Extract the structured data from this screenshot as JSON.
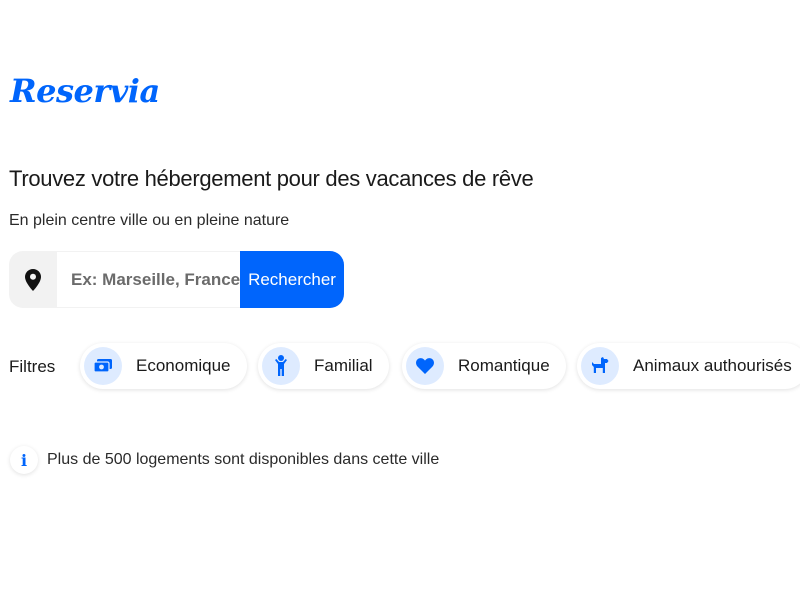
{
  "brand": {
    "name": "Reservia",
    "color": "#0065fc"
  },
  "hero": {
    "title": "Trouvez votre hébergement pour des vacances de rêve",
    "subtitle": "En plein centre ville ou en pleine nature"
  },
  "search": {
    "icon": "map-pin-icon",
    "placeholder": "Ex: Marseille, France",
    "value": "",
    "button_label": "Rechercher"
  },
  "filters": {
    "label": "Filtres",
    "items": [
      {
        "label": "Economique",
        "icon": "money-icon"
      },
      {
        "label": "Familial",
        "icon": "child-icon"
      },
      {
        "label": "Romantique",
        "icon": "heart-icon"
      },
      {
        "label": "Animaux authourisés",
        "icon": "dog-icon"
      }
    ]
  },
  "info": {
    "icon": "info-icon",
    "glyph": "i",
    "text": "Plus de 500 logements sont disponibles dans cette ville"
  },
  "colors": {
    "accent": "#0065fc",
    "chip_icon_bg": "#deebff",
    "search_icon_bg": "#f2f2f2"
  }
}
